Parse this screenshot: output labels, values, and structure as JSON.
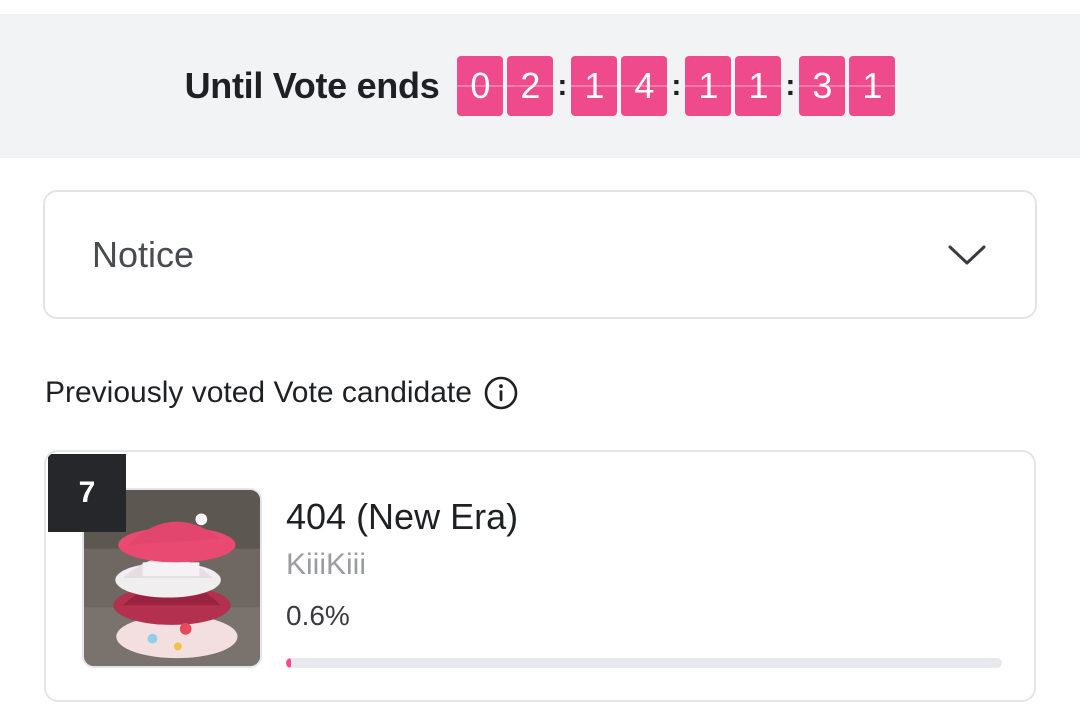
{
  "countdown": {
    "label": "Until Vote ends",
    "groups": [
      [
        "0",
        "2"
      ],
      [
        "1",
        "4"
      ],
      [
        "1",
        "1"
      ],
      [
        "3",
        "1"
      ]
    ],
    "separator": ":",
    "accent": "#ef4b8c"
  },
  "notice": {
    "title": "Notice",
    "icon": "chevron-down-icon"
  },
  "previous": {
    "heading": "Previously voted Vote candidate",
    "info_icon": "info-icon"
  },
  "candidate": {
    "rank": "7",
    "title": "404 (New Era)",
    "artist": "KiiiKiii",
    "percent_text": "0.6%",
    "progress_fraction": 0.006,
    "thumbnail_icon": "album-cover-image"
  }
}
